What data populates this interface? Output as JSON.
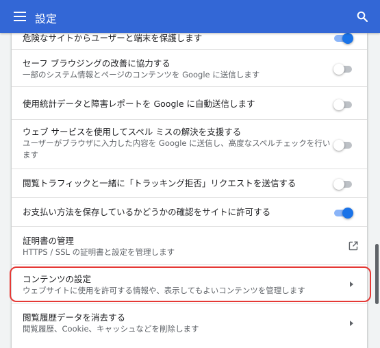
{
  "header": {
    "title": "設定",
    "bg_color": "#3367d6"
  },
  "rows": [
    {
      "title": "危険なサイトからユーザーと端末を保護します",
      "control": "toggle",
      "state": "on"
    },
    {
      "title": "セーフ ブラウジングの改善に協力する",
      "desc": "一部のシステム情報とページのコンテンツを Google に送信します",
      "control": "toggle",
      "state": "off"
    },
    {
      "title": "使用統計データと障害レポートを Google に自動送信します",
      "control": "toggle",
      "state": "off"
    },
    {
      "title": "ウェブ サービスを使用してスペル ミスの解決を支援する",
      "desc": "ユーザーがブラウザに入力した内容を Google に送信し、高度なスペルチェックを行い",
      "desc2": "ます",
      "control": "toggle",
      "state": "off"
    },
    {
      "title": "閲覧トラフィックと一緒に「トラッキング拒否」リクエストを送信する",
      "control": "toggle",
      "state": "off"
    },
    {
      "title": "お支払い方法を保存しているかどうかの確認をサイトに許可する",
      "control": "toggle",
      "state": "on"
    },
    {
      "title": "証明書の管理",
      "desc": "HTTPS / SSL の証明書と設定を管理します",
      "control": "external-link-icon"
    },
    {
      "title": "コンテンツの設定",
      "desc": "ウェブサイトに使用を許可する情報や、表示してもよいコンテンツを管理します",
      "control": "arrow",
      "highlighted": true
    },
    {
      "title": "閲覧履歴データを消去する",
      "desc": "閲覧履歴、Cookie、キャッシュなどを削除します",
      "control": "arrow"
    }
  ],
  "colors": {
    "accent": "#1a73e8",
    "highlight_border": "#e53935"
  }
}
